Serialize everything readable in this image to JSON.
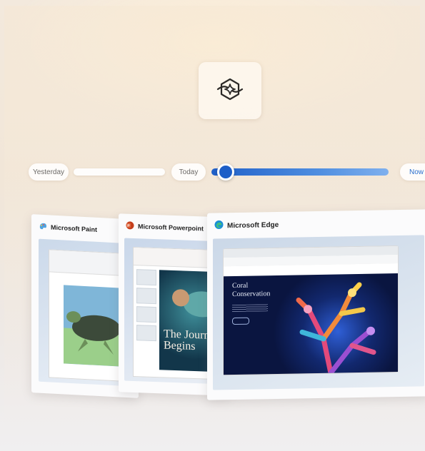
{
  "timeline": {
    "yesterday_label": "Yesterday",
    "today_label": "Today",
    "now_label": "Now",
    "position_fraction": 0.08
  },
  "windows": [
    {
      "app": "Microsoft Paint",
      "icon": "paint-icon"
    },
    {
      "app": "Microsoft Powerpoint",
      "icon": "powerpoint-icon",
      "slide_text": "The Journey Begins"
    },
    {
      "app": "Microsoft Edge",
      "icon": "edge-icon",
      "page_heading": "Coral Conservation"
    }
  ],
  "colors": {
    "accent": "#1d5ec7",
    "powerpoint": "#c43e1c",
    "edge": "#1a8fd6"
  }
}
